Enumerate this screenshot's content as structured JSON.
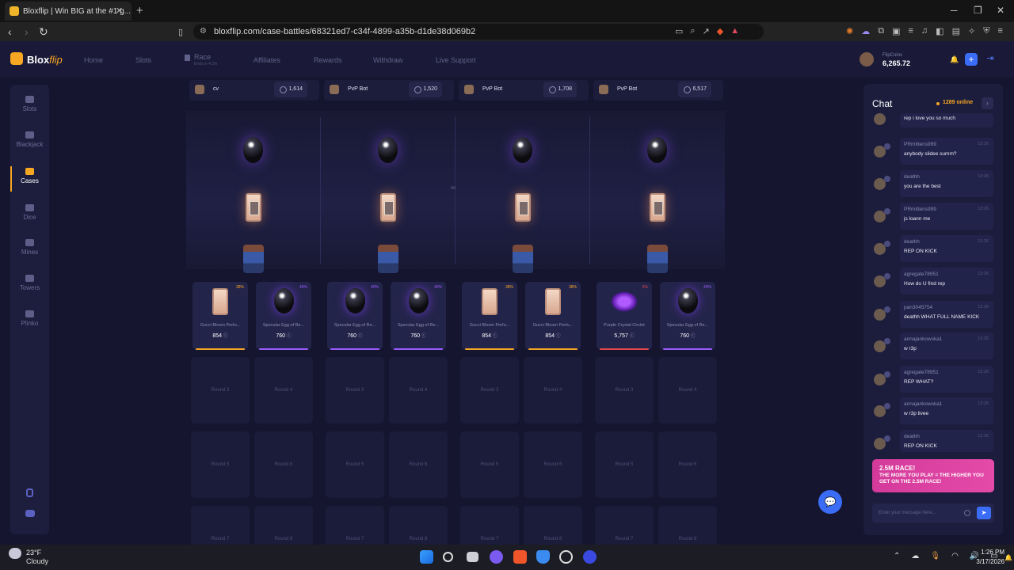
{
  "browser": {
    "tab_title": "Bloxflip | Win BIG at the #1 g...",
    "url": "bloxflip.com/case-battles/68321ed7-c34f-4899-a35b-d1de38d069b2"
  },
  "site": {
    "logo_main": "Blox",
    "logo_accent": "flip",
    "nav": [
      "Home",
      "Slots",
      "Race",
      "Affiliates",
      "Rewards",
      "Withdraw",
      "Live Support"
    ],
    "race_sub": "Ends in 4.2m",
    "coins_label": "FlipCoins",
    "coins_amount": "6,265.72"
  },
  "sidebar": [
    {
      "label": "Slots",
      "active": false
    },
    {
      "label": "Blackjack",
      "active": false
    },
    {
      "label": "Cases",
      "active": true
    },
    {
      "label": "Dice",
      "active": false
    },
    {
      "label": "Mines",
      "active": false
    },
    {
      "label": "Towers",
      "active": false
    },
    {
      "label": "Plinko",
      "active": false
    }
  ],
  "players": [
    {
      "name": "cv",
      "value": "1,614"
    },
    {
      "name": "PvP Bot",
      "value": "1,520"
    },
    {
      "name": "PvP Bot",
      "value": "1,708"
    },
    {
      "name": "PvP Bot",
      "value": "6,517"
    }
  ],
  "vs_label": "vs",
  "drops": [
    {
      "name": "Gucci Bloom Perfu...",
      "value": "854",
      "pct": "38%",
      "color": "#f5a623",
      "type": "perfume"
    },
    {
      "name": "Specular Egg of Re...",
      "value": "760",
      "pct": "40%",
      "color": "#9b5cff",
      "type": "egg"
    },
    {
      "name": "Specular Egg of Re...",
      "value": "760",
      "pct": "40%",
      "color": "#9b5cff",
      "type": "egg"
    },
    {
      "name": "Specular Egg of Re...",
      "value": "760",
      "pct": "40%",
      "color": "#9b5cff",
      "type": "egg"
    },
    {
      "name": "Gucci Bloom Perfu...",
      "value": "854",
      "pct": "38%",
      "color": "#f5a623",
      "type": "perfume"
    },
    {
      "name": "Gucci Bloom Perfu...",
      "value": "854",
      "pct": "38%",
      "color": "#f5a623",
      "type": "perfume"
    },
    {
      "name": "Purple Crystal Circlet",
      "value": "5,757",
      "pct": "5%",
      "color": "#e0484a",
      "type": "crystal"
    },
    {
      "name": "Specular Egg of Re...",
      "value": "760",
      "pct": "40%",
      "color": "#9b5cff",
      "type": "egg"
    }
  ],
  "rounds": [
    [
      "Round 3",
      "Round 4",
      "Round 3",
      "Round 4",
      "Round 3",
      "Round 4",
      "Round 3",
      "Round 4"
    ],
    [
      "Round 5",
      "Round 6",
      "Round 5",
      "Round 6",
      "Round 5",
      "Round 6",
      "Round 5",
      "Round 6"
    ],
    [
      "Round 7",
      "Round 8",
      "Round 7",
      "Round 8",
      "Round 7",
      "Round 8",
      "Round 7",
      "Round 8"
    ]
  ],
  "chat": {
    "title": "Chat",
    "online": "1289 online",
    "messages": [
      {
        "user": "",
        "time": "",
        "text": "rep i love you so much"
      },
      {
        "user": "PRmittens999",
        "time": "13:26",
        "text": "anybody slidee summ?"
      },
      {
        "user": "deathh",
        "time": "13:26",
        "text": "you are the best"
      },
      {
        "user": "PRmittens999",
        "time": "13:26",
        "text": "js loann me"
      },
      {
        "user": "deathh",
        "time": "13:26",
        "text": "REP ON KICK"
      },
      {
        "user": "agregate78951",
        "time": "13:26",
        "text": "How do U find rep"
      },
      {
        "user": "pan3045754",
        "time": "13:26",
        "text": "deathh WHAT FULL NAME KICK"
      },
      {
        "user": "annajankowska1",
        "time": "13:26",
        "text": "w r3p"
      },
      {
        "user": "agregate78951",
        "time": "13:26",
        "text": "REP WHAT?"
      },
      {
        "user": "annajankowska1",
        "time": "13:26",
        "text": "w r3p livee"
      },
      {
        "user": "deathh",
        "time": "13:26",
        "text": "REP ON KICK"
      }
    ],
    "race_banner_title": "2.5M RACE!",
    "race_banner_text": "THE MORE YOU PLAY = THE HIGHER YOU GET ON THE 2.5M RACE!",
    "input_placeholder": "Enter your message here..."
  },
  "taskbar": {
    "temp": "23°F",
    "condition": "Cloudy",
    "time": "1:26 PM",
    "date": "3/17/2026"
  }
}
